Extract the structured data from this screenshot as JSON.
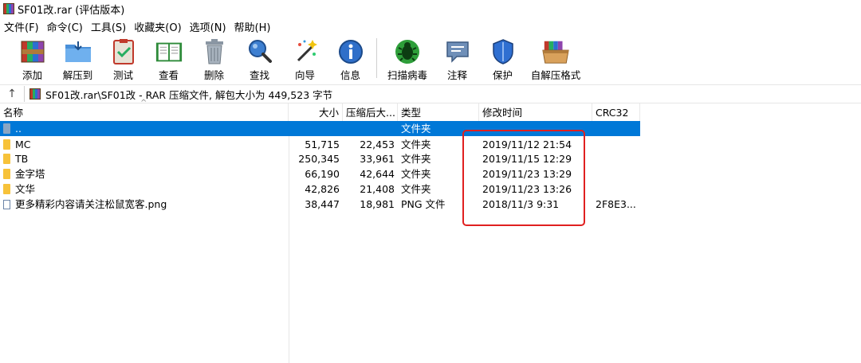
{
  "window": {
    "title": "SF01改.rar (评估版本)"
  },
  "menu": [
    "文件(F)",
    "命令(C)",
    "工具(S)",
    "收藏夹(O)",
    "选项(N)",
    "帮助(H)"
  ],
  "toolbar": [
    {
      "label": "添加",
      "icon": "add-archive-icon"
    },
    {
      "label": "解压到",
      "icon": "extract-to-folder-icon"
    },
    {
      "label": "测试",
      "icon": "test-clipboard-icon"
    },
    {
      "label": "查看",
      "icon": "view-book-icon"
    },
    {
      "label": "删除",
      "icon": "trash-icon"
    },
    {
      "label": "查找",
      "icon": "magnifier-icon"
    },
    {
      "label": "向导",
      "icon": "wizard-wand-icon"
    },
    {
      "label": "信息",
      "icon": "info-icon"
    },
    {
      "label": "扫描病毒",
      "icon": "virus-scan-icon"
    },
    {
      "label": "注释",
      "icon": "comment-icon"
    },
    {
      "label": "保护",
      "icon": "shield-icon"
    },
    {
      "label": "自解压格式",
      "icon": "sfx-box-icon"
    }
  ],
  "address": {
    "up_symbol": "↑",
    "path": "SF01改.rar\\SF01改 - RAR 压缩文件, 解包大小为 449,523 字节"
  },
  "columns": {
    "name": "名称",
    "size": "大小",
    "packed": "压缩后大...",
    "type": "类型",
    "modified": "修改时间",
    "crc": "CRC32",
    "sort_indicator": "^"
  },
  "files": [
    {
      "name": "..",
      "size": "",
      "packed": "",
      "type": "文件夹",
      "modified": "",
      "crc": "",
      "kind": "parent",
      "selected": true
    },
    {
      "name": "MC",
      "size": "51,715",
      "packed": "22,453",
      "type": "文件夹",
      "modified": "2019/11/12 21:54",
      "crc": "",
      "kind": "folder"
    },
    {
      "name": "TB",
      "size": "250,345",
      "packed": "33,961",
      "type": "文件夹",
      "modified": "2019/11/15 12:29",
      "crc": "",
      "kind": "folder"
    },
    {
      "name": "金字塔",
      "size": "66,190",
      "packed": "42,644",
      "type": "文件夹",
      "modified": "2019/11/23 13:29",
      "crc": "",
      "kind": "folder"
    },
    {
      "name": "文华",
      "size": "42,826",
      "packed": "21,408",
      "type": "文件夹",
      "modified": "2019/11/23 13:26",
      "crc": "",
      "kind": "folder"
    },
    {
      "name": "更多精彩内容请关注松鼠宽客.png",
      "size": "38,447",
      "packed": "18,981",
      "type": "PNG 文件",
      "modified": "2018/11/3 9:31",
      "crc": "2F8E3...",
      "kind": "file"
    }
  ],
  "colors": {
    "selection": "#0078d7",
    "highlight_box": "#e02020"
  }
}
